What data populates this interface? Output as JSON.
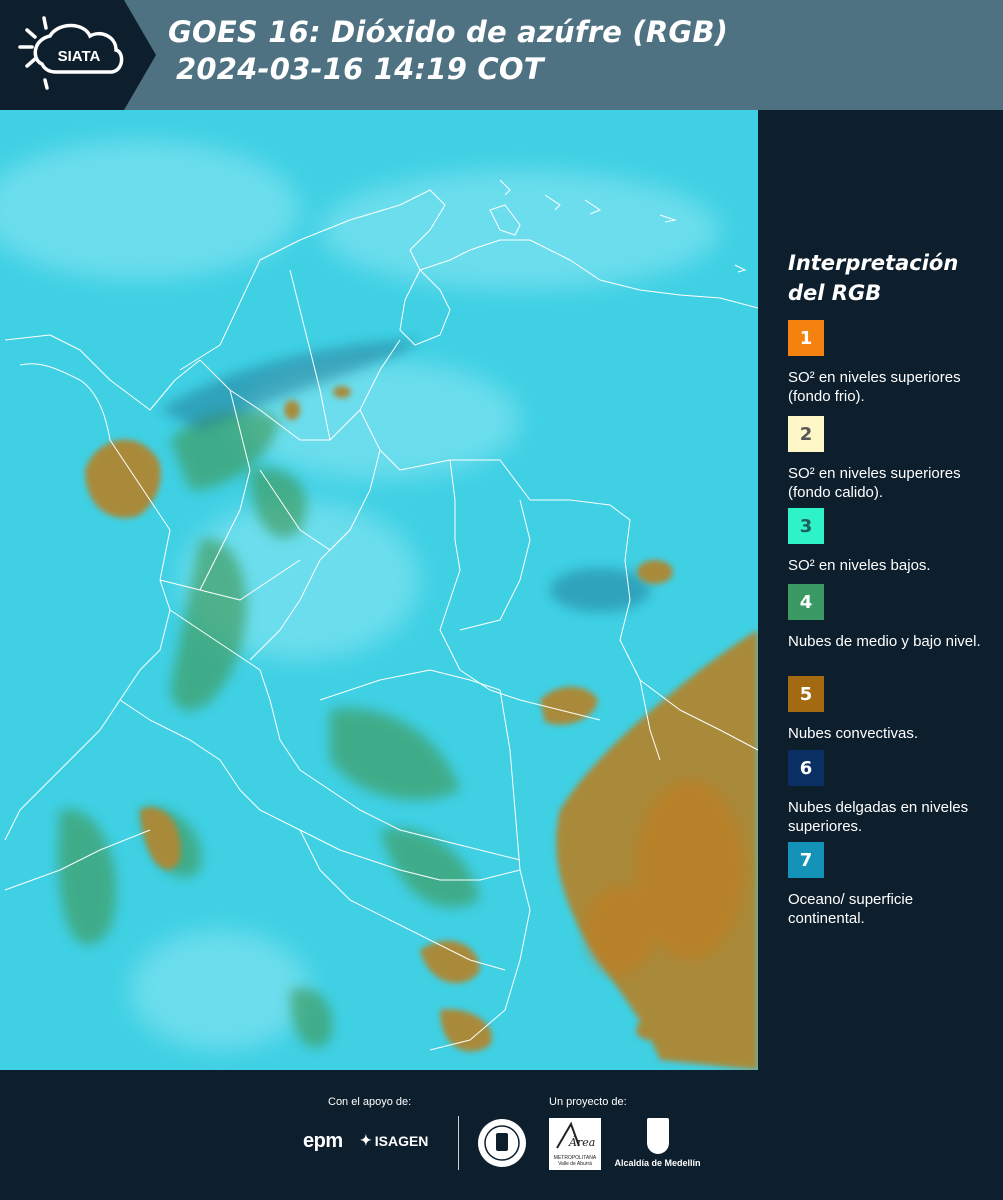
{
  "header": {
    "logo_text": "SIATA",
    "title_line1": "GOES 16: Dióxido de azúfre (RGB)",
    "title_line2": "2024-03-16 14:19 COT"
  },
  "legend": {
    "title_line1": "Interpretación",
    "title_line2": "del RGB",
    "items": [
      {
        "number": "1",
        "color": "#f5820f",
        "text_color": "#ffffff",
        "label": "SO² en niveles superiores (fondo frio)."
      },
      {
        "number": "2",
        "color": "#fdf6c6",
        "text_color": "#555555",
        "label": "SO² en niveles superiores (fondo calido)."
      },
      {
        "number": "3",
        "color": "#2ef2c8",
        "text_color": "#1d5f5a",
        "label": "SO² en niveles bajos."
      },
      {
        "number": "4",
        "color": "#3b9a63",
        "text_color": "#ffffff",
        "label": "Nubes de medio y bajo nivel."
      },
      {
        "number": "5",
        "color": "#a46a12",
        "text_color": "#ffffff",
        "label": "Nubes convectivas."
      },
      {
        "number": "6",
        "color": "#0b2f62",
        "text_color": "#ffffff",
        "label": "Nubes delgadas en niveles superiores."
      },
      {
        "number": "7",
        "color": "#1492b8",
        "text_color": "#ffffff",
        "label": "Oceano/ superficie continental."
      }
    ]
  },
  "footer": {
    "support_label": "Con el apoyo de:",
    "project_label": "Un proyecto de:",
    "sponsor1": "epm",
    "sponsor2": "ISAGEN",
    "project_logo_area": "Área",
    "project_logo_area_sub": "METROPOLITANA Valle de Aburrá",
    "project_logo_alcaldia": "Alcaldía de Medellín"
  },
  "map": {
    "background_color": "#3fd0e4",
    "convective_color": "#a98a3a",
    "low_cloud_color": "#3f9a5a",
    "border_color": "#ffffff"
  }
}
